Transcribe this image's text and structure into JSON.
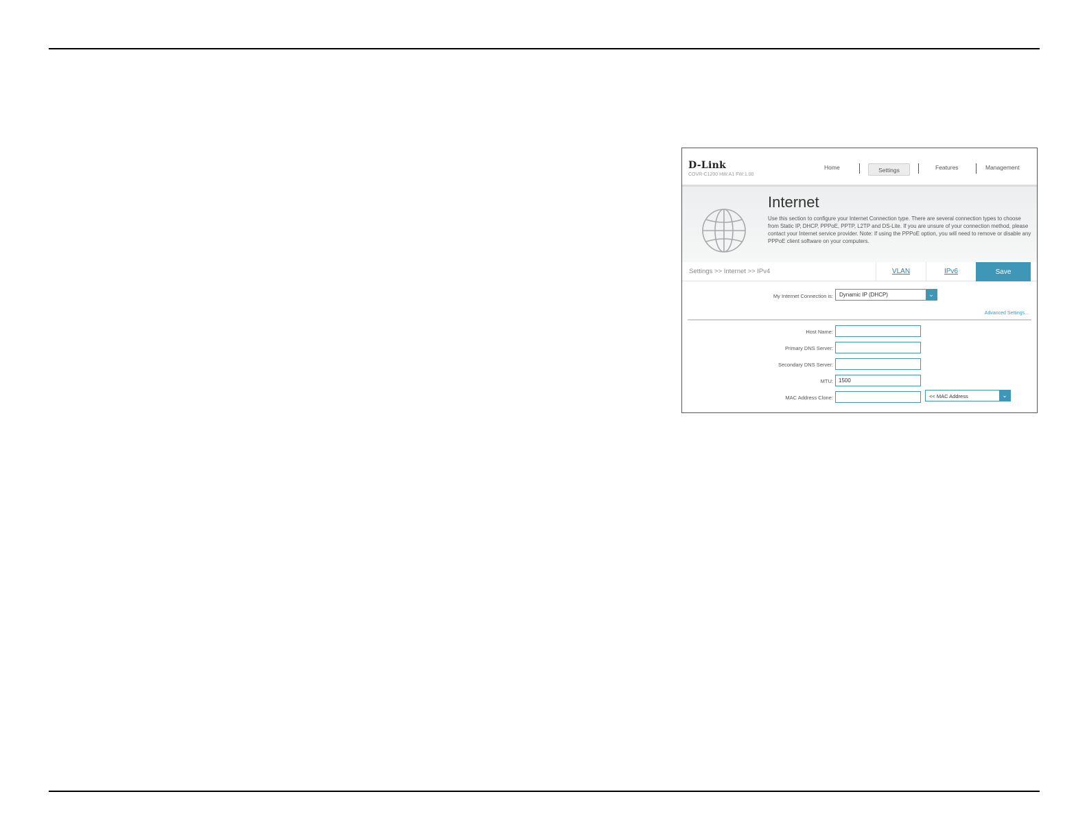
{
  "ui": {
    "brand": "D-Link",
    "model": "COVR-C1200 HW:A1 FW:1.00",
    "nav": {
      "home": "Home",
      "settings": "Settings",
      "features": "Features",
      "management": "Management"
    },
    "banner": {
      "title": "Internet",
      "description": "Use this section to configure your Internet Connection type. There are several connection types to choose from Static IP, DHCP, PPPoE, PPTP, L2TP and DS-Lite. If you are unsure of your connection method, please contact your Internet service provider. Note: If using the PPPoE option, you will need to remove or disable any PPPoE client software on your computers."
    },
    "breadcrumb": "Settings >> Internet >> IPv4",
    "tabs": {
      "vlan": "VLAN",
      "ipv6": "IPv6",
      "save": "Save"
    },
    "connection": {
      "label": "My Internet Connection is:",
      "value": "Dynamic IP (DHCP)"
    },
    "advanced_link": "Advanced Settings...",
    "fields": {
      "host_name": {
        "label": "Host Name:",
        "value": ""
      },
      "primary_dns": {
        "label": "Primary DNS Server:",
        "value": ""
      },
      "secondary_dns": {
        "label": "Secondary DNS Server:",
        "value": ""
      },
      "mtu": {
        "label": "MTU:",
        "value": "1500"
      },
      "mac_clone": {
        "label": "MAC Address Clone:",
        "value": "",
        "select": "<< MAC Address"
      }
    },
    "accent_color": "#3f97b8"
  }
}
